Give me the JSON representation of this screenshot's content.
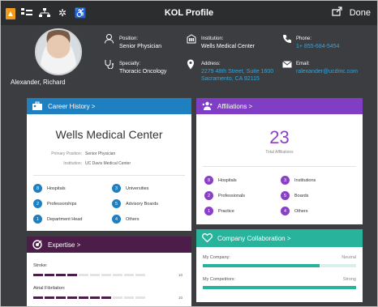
{
  "topbar": {
    "title": "KOL Profile",
    "done_label": "Done",
    "left_icons": [
      "home-icon",
      "org-chart-icon",
      "network-icon",
      "settings-icon",
      "wheelchair-icon"
    ]
  },
  "profile": {
    "name": "Alexander, Richard",
    "position_label": "Position:",
    "position_value": "Senior Physician",
    "specialty_label": "Specialty:",
    "specialty_value": "Thoracic Oncology",
    "institution_label": "Institution:",
    "institution_value": "Wells Medical Center",
    "address_label": "Address:",
    "address_line1": "2279 48th Street, Suite 1600",
    "address_line2": "Sacramento, CA 92115",
    "phone_label": "Phone:",
    "phone_value": "1+ 855-684-5454",
    "email_label": "Email:",
    "email_value": "ralexander@ucdmc.com"
  },
  "career": {
    "header": "Career History  >",
    "institution": "Wells Medical Center",
    "primary_position_label": "Primary Position:",
    "primary_position_value": "Senior Physician",
    "institution_label": "Institution:",
    "institution_value": "UC Davis Medical Center",
    "stats": [
      {
        "num": "8",
        "label": "Hospitals"
      },
      {
        "num": "3",
        "label": "Universities"
      },
      {
        "num": "2",
        "label": "Professorships"
      },
      {
        "num": "5",
        "label": "Advisory Boards"
      },
      {
        "num": "1",
        "label": "Department Head"
      },
      {
        "num": "4",
        "label": "Others"
      }
    ]
  },
  "affiliations": {
    "header": "Affiliations  >",
    "total": "23",
    "total_label": "Total Affiliations",
    "stats": [
      {
        "num": "8",
        "label": "Hospitals"
      },
      {
        "num": "3",
        "label": "Institutions"
      },
      {
        "num": "2",
        "label": "Professionals"
      },
      {
        "num": "5",
        "label": "Boards"
      },
      {
        "num": "1",
        "label": "Practice"
      },
      {
        "num": "4",
        "label": "Others"
      }
    ]
  },
  "expertise": {
    "header": "Expertise  >",
    "items": [
      {
        "label": "Stroke:",
        "level": 4,
        "max": "10"
      },
      {
        "label": "Atrial Fibrilation:",
        "level": 7,
        "max": "10"
      }
    ]
  },
  "collaboration": {
    "header": "Company Collaboration  >",
    "rows": [
      {
        "label": "My Company:",
        "status": "Neutral",
        "fill": 0.76
      },
      {
        "label": "My Competitors:",
        "status": "Strong",
        "fill": 1.0
      }
    ]
  },
  "colors": {
    "career": "#1e7fc1",
    "affiliations": "#7f3ec4",
    "expertise": "#4d1d4a",
    "collaboration": "#27b39c",
    "link": "#2da8e0"
  }
}
